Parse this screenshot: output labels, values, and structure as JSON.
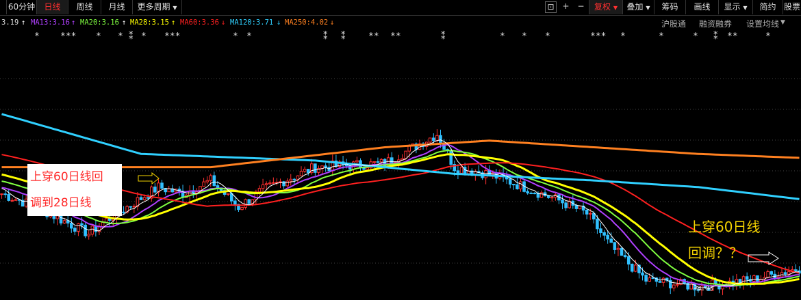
{
  "toolbar": {
    "left_buttons": [
      "60分钟",
      "日线",
      "周线",
      "月线",
      "更多周期"
    ],
    "active": "日线",
    "icons": [
      "lock-icon",
      "plus-icon",
      "minus-icon"
    ],
    "right_buttons": [
      "复权",
      "叠加",
      "筹码",
      "画线",
      "显示",
      "简约",
      "股票"
    ],
    "right_active": "复权"
  },
  "ma_bar": {
    "first_value": "3.19",
    "items": [
      {
        "label": "MA13:3.16",
        "color": "#b040ff",
        "arrow": "↑",
        "arrow_color": "#b040ff"
      },
      {
        "label": "MA20:3.16",
        "color": "#80ff40",
        "arrow": "↑",
        "arrow_color": "#ffffff"
      },
      {
        "label": "MA28:3.15",
        "color": "#ffff00",
        "arrow": "↑",
        "arrow_color": "#ffff00"
      },
      {
        "label": "MA60:3.36",
        "color": "#ff2020",
        "arrow": "↓",
        "arrow_color": "#ff2020"
      },
      {
        "label": "MA120:3.71",
        "color": "#30d0ff",
        "arrow": "↓",
        "arrow_color": "#30d0ff"
      },
      {
        "label": "MA250:4.02",
        "color": "#ff8020",
        "arrow": "↓",
        "arrow_color": "#ff8020"
      }
    ],
    "right_links": [
      "沪股通",
      "融资融券",
      "设置均线"
    ]
  },
  "annotations": {
    "left_note_line1": "上穿60日线回",
    "left_note_line2": "调到28日线",
    "right_note_line1": "上穿60日线",
    "right_note_line2": "回调？？",
    "low_label": "3.03"
  },
  "chart_data": {
    "type": "line",
    "x_count": 230,
    "series": [
      {
        "name": "MA13",
        "color": "#b040ff",
        "values_ref": "ma13"
      },
      {
        "name": "MA20",
        "color": "#80ff40",
        "values_ref": "ma20"
      },
      {
        "name": "MA28",
        "color": "#ffff00",
        "values_ref": "ma28"
      },
      {
        "name": "MA60",
        "color": "#ff2020",
        "values_ref": "ma60"
      },
      {
        "name": "MA120",
        "color": "#30d0ff",
        "values_ref": "ma120"
      },
      {
        "name": "MA250",
        "color": "#ff8020",
        "values_ref": "ma250"
      }
    ],
    "last_values": {
      "MA13": 3.16,
      "MA20": 3.16,
      "MA28": 3.15,
      "MA60": 3.36,
      "MA120": 3.71,
      "MA250": 4.02
    },
    "low_marker": 3.03,
    "ylim": [
      2.95,
      4.9
    ],
    "grid": true
  },
  "colors": {
    "up": "#ff3030",
    "down": "#30c0ff",
    "grid": "#444444",
    "background": "#000000"
  }
}
